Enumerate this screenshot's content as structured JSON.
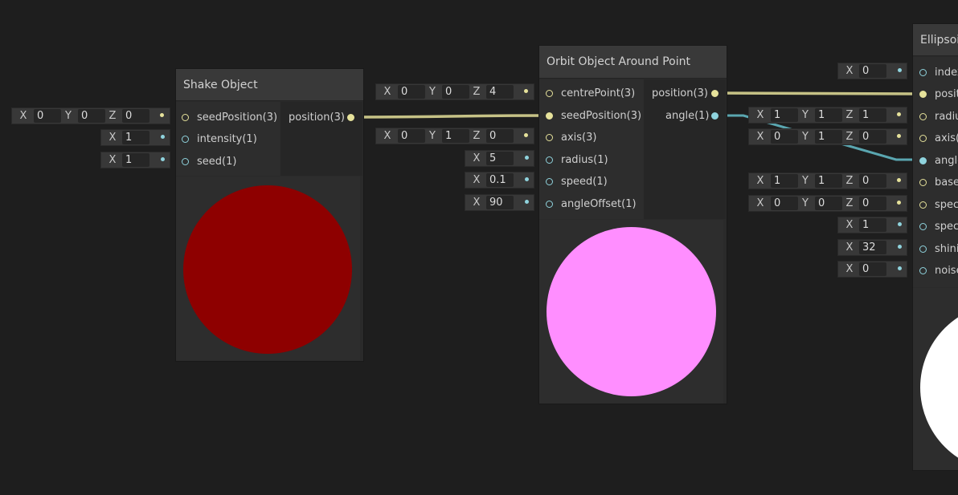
{
  "colors": {
    "background": "#1e1e1e",
    "vector_port": "#e6e29b",
    "float_port": "#8fd3dd",
    "shake_preview": "#8e0000",
    "orbit_preview": "#ff8eff",
    "ellipsoid_preview": "#ffffff"
  },
  "nodes": {
    "shake": {
      "title": "Shake Object",
      "inputs": [
        {
          "label": "seedPosition(3)",
          "type": "vector",
          "fields": [
            {
              "axis": "X",
              "value": "0"
            },
            {
              "axis": "Y",
              "value": "0"
            },
            {
              "axis": "Z",
              "value": "0"
            }
          ]
        },
        {
          "label": "intensity(1)",
          "type": "float",
          "fields": [
            {
              "axis": "X",
              "value": "1"
            }
          ]
        },
        {
          "label": "seed(1)",
          "type": "float",
          "fields": [
            {
              "axis": "X",
              "value": "1"
            }
          ]
        }
      ],
      "outputs": [
        {
          "label": "position(3)",
          "type": "vector"
        }
      ]
    },
    "orbit": {
      "title": "Orbit Object Around Point",
      "inputs": [
        {
          "label": "centrePoint(3)",
          "type": "vector",
          "fields": [
            {
              "axis": "X",
              "value": "0"
            },
            {
              "axis": "Y",
              "value": "0"
            },
            {
              "axis": "Z",
              "value": "4"
            }
          ]
        },
        {
          "label": "seedPosition(3)",
          "type": "vector",
          "fields": []
        },
        {
          "label": "axis(3)",
          "type": "vector",
          "fields": [
            {
              "axis": "X",
              "value": "0"
            },
            {
              "axis": "Y",
              "value": "1"
            },
            {
              "axis": "Z",
              "value": "0"
            }
          ]
        },
        {
          "label": "radius(1)",
          "type": "float",
          "fields": [
            {
              "axis": "X",
              "value": "5"
            }
          ]
        },
        {
          "label": "speed(1)",
          "type": "float",
          "fields": [
            {
              "axis": "X",
              "value": "0.1"
            }
          ]
        },
        {
          "label": "angleOffset(1)",
          "type": "float",
          "fields": [
            {
              "axis": "X",
              "value": "90"
            }
          ]
        }
      ],
      "outputs": [
        {
          "label": "position(3)",
          "type": "vector"
        },
        {
          "label": "angle(1)",
          "type": "float"
        }
      ]
    },
    "ellipsoid": {
      "title": "Ellipsoid",
      "inputs": [
        {
          "label": "index",
          "type": "float",
          "fields": [
            {
              "axis": "X",
              "value": "0"
            }
          ]
        },
        {
          "label": "posit",
          "type": "vector",
          "fields": []
        },
        {
          "label": "radiu",
          "type": "vector",
          "fields": [
            {
              "axis": "X",
              "value": "1"
            },
            {
              "axis": "Y",
              "value": "1"
            },
            {
              "axis": "Z",
              "value": "1"
            }
          ]
        },
        {
          "label": "axis(",
          "type": "vector",
          "fields": [
            {
              "axis": "X",
              "value": "0"
            },
            {
              "axis": "Y",
              "value": "1"
            },
            {
              "axis": "Z",
              "value": "0"
            }
          ]
        },
        {
          "label": "angle",
          "type": "float",
          "fields": []
        },
        {
          "label": "base",
          "type": "vector",
          "fields": [
            {
              "axis": "X",
              "value": "1"
            },
            {
              "axis": "Y",
              "value": "1"
            },
            {
              "axis": "Z",
              "value": "0"
            }
          ]
        },
        {
          "label": "spec",
          "type": "vector",
          "fields": [
            {
              "axis": "X",
              "value": "0"
            },
            {
              "axis": "Y",
              "value": "0"
            },
            {
              "axis": "Z",
              "value": "0"
            }
          ]
        },
        {
          "label": "spec",
          "type": "float",
          "fields": [
            {
              "axis": "X",
              "value": "1"
            }
          ]
        },
        {
          "label": "shinir",
          "type": "float",
          "fields": [
            {
              "axis": "X",
              "value": "32"
            }
          ]
        },
        {
          "label": "noise",
          "type": "float",
          "fields": [
            {
              "axis": "X",
              "value": "0"
            }
          ]
        }
      ]
    }
  }
}
